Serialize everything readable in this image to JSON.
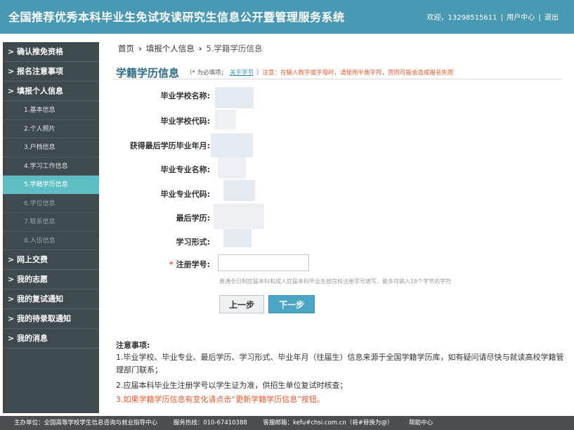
{
  "header": {
    "title": "全国推荐优秀本科毕业生免试攻读研究生信息公开暨管理服务系统",
    "welcome": "欢迎，13298515611",
    "sep": "|",
    "user_center": "用户中心",
    "logout": "退出"
  },
  "sidebar": {
    "items": [
      {
        "label": "> 确认推免资格"
      },
      {
        "label": "> 报名注意事项"
      },
      {
        "label": "> 填报个人信息"
      }
    ],
    "sub_items": [
      {
        "label": "1.基本信息"
      },
      {
        "label": "2.个人照片"
      },
      {
        "label": "3.户档信息"
      },
      {
        "label": "4.学习工作信息"
      },
      {
        "label": "5.学籍学历信息"
      },
      {
        "label": "6.学位信息"
      },
      {
        "label": "7.联系信息"
      },
      {
        "label": "8.入伍信息"
      }
    ],
    "items2": [
      {
        "label": "> 网上交费"
      },
      {
        "label": "> 我的志愿"
      },
      {
        "label": "> 我的复试通知"
      },
      {
        "label": "> 我的待录取通知"
      },
      {
        "label": "> 我的消息"
      }
    ]
  },
  "breadcrumb": {
    "home": "首页",
    "sep": "›",
    "step": "填报个人信息",
    "current": "5.学籍学历信息"
  },
  "section": {
    "title": "学籍学历信息",
    "required_note": "（* 为必填项；",
    "link": "关于字节",
    "close_paren": "）",
    "warning": "注意：在输入数字或字母时，请使用半角字符，否则可能会造成报名失败"
  },
  "form": {
    "labels": {
      "school_name": "毕业学校名称:",
      "school_code": "毕业学校代码:",
      "grad_date": "获得最后学历毕业年月:",
      "major_name": "毕业专业名称:",
      "major_code": "毕业专业代码:",
      "education": "最后学历:",
      "study_form": "学习形式:",
      "reg_number": "注册学号:"
    },
    "required_star": "*",
    "reg_number_value": "",
    "hint": "普通全日制应届本科和成人应届本科毕业生按在校注册学号填写，最多可输入18个字节的字符"
  },
  "buttons": {
    "prev": "上一步",
    "next": "下一步"
  },
  "notes": {
    "title": "注意事项:",
    "line1": "1.毕业学校、毕业专业、最后学历、学习形式、毕业年月（往届生）信息来源于全国学籍学历库，如有疑问请尽快与就读高校学籍管理部门联系；",
    "line2": "2.应届本科毕业生注册学号以学生证为准，供招生单位复试时核查；",
    "line3": "3.如果学籍学历信息有变化请点击“更新学籍学历信息”按钮。"
  },
  "footer": {
    "sponsor": "主办单位：全国高等学校学生信息咨询与就业指导中心",
    "hotline": "服务热线：010-67410388",
    "email": "客服邮箱：kefu#chsi.com.cn（将#替换为@）",
    "help": "帮助中心"
  },
  "colors": {
    "header_bg": "#4a99b3",
    "sidebar_bg": "#3f4a4f",
    "active_item": "#5dbfc3",
    "accent_red": "#e8582d",
    "next_button": "#4aa6c4"
  }
}
